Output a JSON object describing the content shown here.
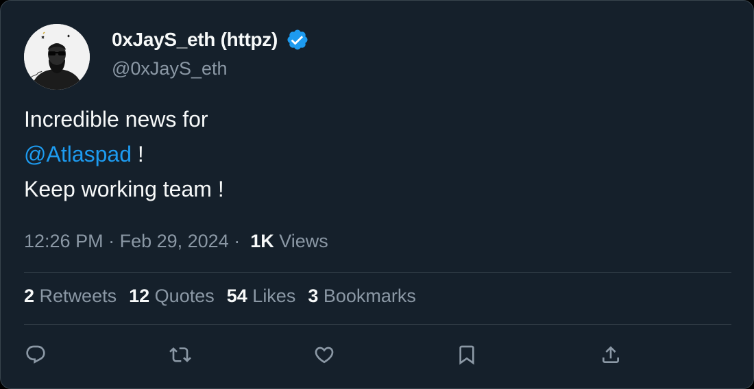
{
  "tweet": {
    "display_name": "0xJayS_eth (httpz)",
    "handle": "@0xJayS_eth",
    "avatar_icon": "profile-avatar",
    "verified_icon": "verified-badge-icon",
    "body": {
      "line1": "Incredible news for",
      "mention": "@Atlaspad",
      "after_mention": " !",
      "line3": "Keep working team !"
    },
    "time": "12:26 PM",
    "date": "Feb 29, 2024",
    "views_count": "1K",
    "views_label": "Views"
  },
  "stats": {
    "retweets_count": "2",
    "retweets_label": "Retweets",
    "quotes_count": "12",
    "quotes_label": "Quotes",
    "likes_count": "54",
    "likes_label": "Likes",
    "bookmarks_count": "3",
    "bookmarks_label": "Bookmarks"
  },
  "actions": [
    "reply-icon",
    "retweet-icon",
    "like-icon",
    "bookmark-icon",
    "share-icon"
  ],
  "colors": {
    "background": "#15202b",
    "border": "#38444d",
    "text_primary": "#f7f9f9",
    "text_secondary": "#8b98a5",
    "accent": "#1d9bf0"
  }
}
